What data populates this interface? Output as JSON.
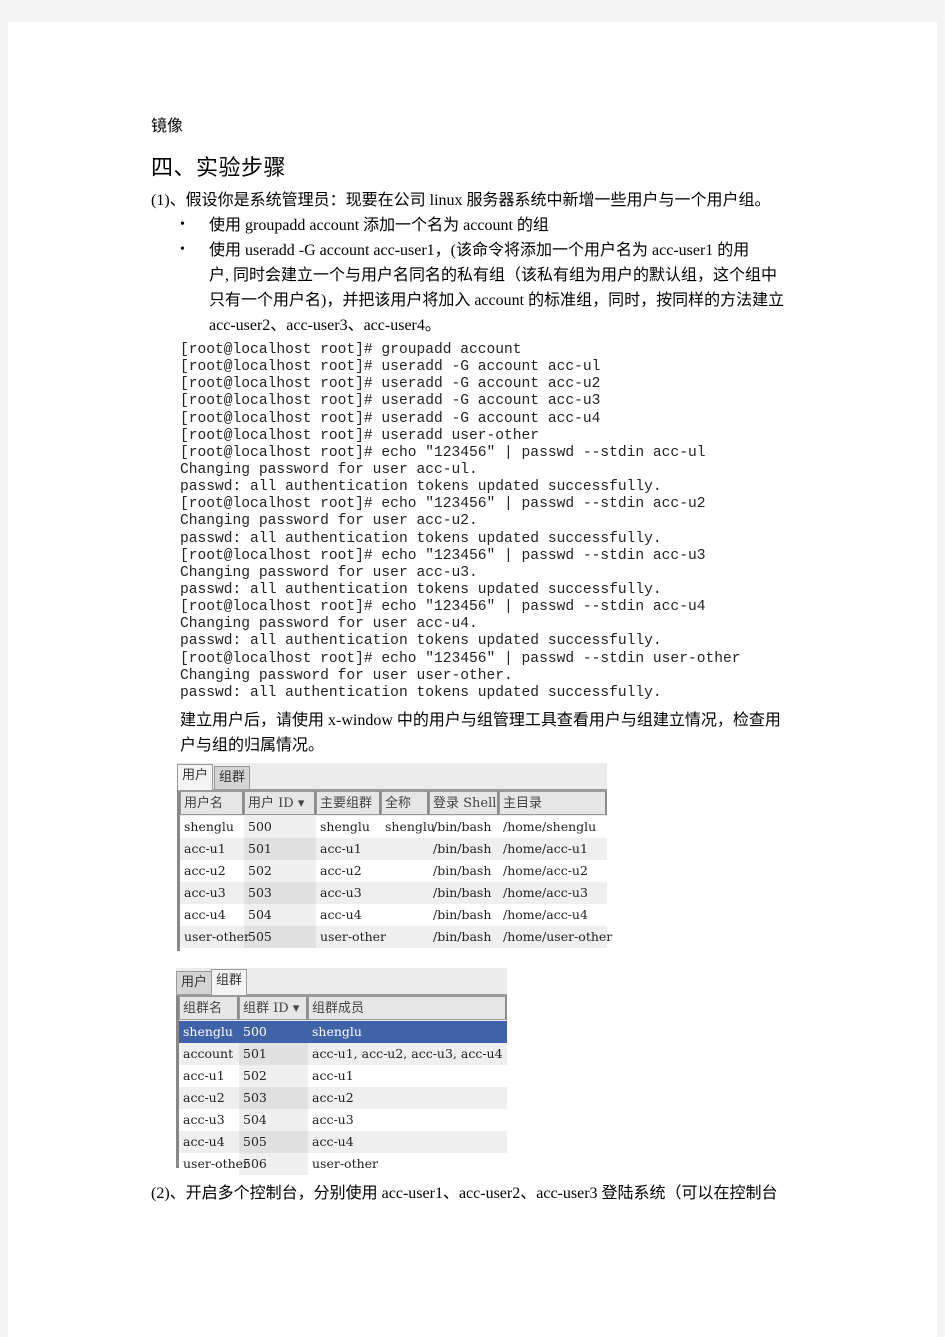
{
  "doc": {
    "intro_word": "镜像",
    "section_heading": "四、实验步骤",
    "step1": "(1)、假设你是系统管理员：现要在公司 linux 服务器系统中新增一些用户与一个用户组。",
    "bullet1": "使用 groupadd    account   添加一个名为 account 的组",
    "bullet2_lines": [
      "使用 useradd    -G    account     acc-user1，(该命令将添加一个用户名为 acc-user1 的用",
      "户, 同时会建立一个与用户名同名的私有组（该私有组为用户的默认组，这个组中",
      "只有一个用户名)，并把该用户将加入 account 的标准组，同时，按同样的方法建立",
      "acc-user2、acc-user3、acc-user4。"
    ],
    "after_lines": [
      "建立用户后，请使用  x-window 中的用户与组管理工具查看用户与组建立情况，检查用",
      "户与组的归属情况。"
    ],
    "step2": "(2)、开启多个控制台，分别使用  acc-user1、acc-user2、acc-user3  登陆系统（可以在控制台"
  },
  "terminal": {
    "lines": [
      "[root@localhost root]# groupadd account",
      "[root@localhost root]# useradd -G account acc-ul",
      "[root@localhost root]# useradd -G account acc-u2",
      "[root@localhost root]# useradd -G account acc-u3",
      "[root@localhost root]# useradd -G account acc-u4",
      "[root@localhost root]# useradd user-other",
      "[root@localhost root]# echo \"123456\" | passwd --stdin acc-ul",
      "Changing password for user acc-ul.",
      "passwd: all authentication tokens updated successfully.",
      "[root@localhost root]# echo \"123456\" | passwd --stdin acc-u2",
      "Changing password for user acc-u2.",
      "passwd: all authentication tokens updated successfully.",
      "[root@localhost root]# echo \"123456\" | passwd --stdin acc-u3",
      "Changing password for user acc-u3.",
      "passwd: all authentication tokens updated successfully.",
      "[root@localhost root]# echo \"123456\" | passwd --stdin acc-u4",
      "Changing password for user acc-u4.",
      "passwd: all authentication tokens updated successfully.",
      "[root@localhost root]# echo \"123456\" | passwd --stdin user-other",
      "Changing password for user user-other.",
      "passwd: all authentication tokens updated successfully."
    ]
  },
  "users_panel": {
    "tabs": [
      "用户",
      "组群"
    ],
    "active_tab": "用户",
    "columns": [
      "用户名",
      "用户 ID ▾",
      "主要组群",
      "全称",
      "登录 Shell",
      "主目录"
    ],
    "rows": [
      [
        "shenglu",
        "500",
        "shenglu",
        "shenglu",
        "/bin/bash",
        "/home/shenglu"
      ],
      [
        "acc-u1",
        "501",
        "acc-u1",
        "",
        "/bin/bash",
        "/home/acc-u1"
      ],
      [
        "acc-u2",
        "502",
        "acc-u2",
        "",
        "/bin/bash",
        "/home/acc-u2"
      ],
      [
        "acc-u3",
        "503",
        "acc-u3",
        "",
        "/bin/bash",
        "/home/acc-u3"
      ],
      [
        "acc-u4",
        "504",
        "acc-u4",
        "",
        "/bin/bash",
        "/home/acc-u4"
      ],
      [
        "user-other",
        "505",
        "user-other",
        "",
        "/bin/bash",
        "/home/user-other"
      ]
    ]
  },
  "groups_panel": {
    "tabs": [
      "用户",
      "组群"
    ],
    "active_tab": "组群",
    "columns": [
      "组群名",
      "组群 ID ▾",
      "组群成员"
    ],
    "selected_row": 0,
    "selection_color": "#4063a8",
    "rows": [
      [
        "shenglu",
        "500",
        "shenglu"
      ],
      [
        "account",
        "501",
        "acc-u1, acc-u2, acc-u3, acc-u4"
      ],
      [
        "acc-u1",
        "502",
        "acc-u1"
      ],
      [
        "acc-u2",
        "503",
        "acc-u2"
      ],
      [
        "acc-u3",
        "504",
        "acc-u3"
      ],
      [
        "acc-u4",
        "505",
        "acc-u4"
      ],
      [
        "user-other",
        "506",
        "user-other"
      ]
    ]
  }
}
